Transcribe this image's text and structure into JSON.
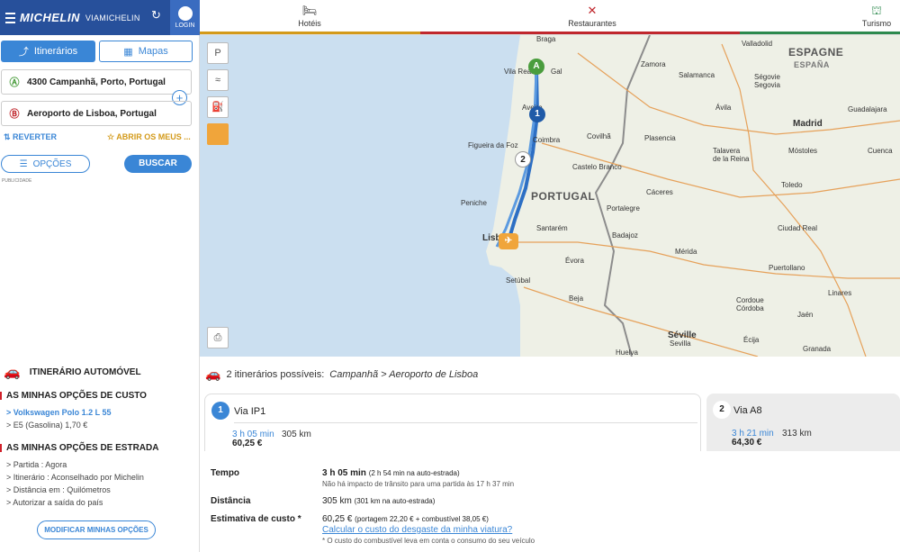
{
  "header": {
    "brand": "MICHELIN",
    "sub": "VIAMICHELIN",
    "login": "LOGIN"
  },
  "topnav": {
    "hotels": "Hotéis",
    "restaurants": "Restaurantes",
    "tourism": "Turismo",
    "hotels_color": "#d39a1a",
    "restaurants_color": "#c0272d",
    "tourism_color": "#2d8a4e"
  },
  "sidebar": {
    "tab_itineraries": "Itinerários",
    "tab_maps": "Mapas",
    "from": "4300 Campanhã, Porto, Portugal",
    "to": "Aeroporto de Lisboa, Portugal",
    "reverse": "REVERTER",
    "open_favs": "ABRIR OS MEUS ...",
    "options": "OPÇÕES",
    "search": "BUSCAR",
    "publicidade": "PUBLICIDADE",
    "itin_type": "ITINERÁRIO AUTOMÓVEL",
    "cost_title": "AS MINHAS OPÇÕES DE CUSTO",
    "car": "Volkswagen Polo 1.2 L 55",
    "fuel": "E5 (Gasolina) 1,70 €",
    "road_title": "AS MINHAS OPÇÕES DE ESTRADA",
    "road_opts": [
      "Partida : Agora",
      "Itinerário : Aconselhado por Michelin",
      "Distância em : Quilómetros",
      "Autorizar a saída do país"
    ],
    "modify": "MODIFICAR MINHAS OPÇÕES"
  },
  "map": {
    "country_es": "ESPAGNE",
    "country_es_sub": "ESPAÑA",
    "country_pt": "PORTUGAL",
    "cities": [
      {
        "name": "Braga"
      },
      {
        "name": "Vila Real"
      },
      {
        "name": "Gal"
      },
      {
        "name": "Zamora"
      },
      {
        "name": "Valladolid"
      },
      {
        "name": "Salamanca"
      },
      {
        "name": "Ségovie"
      },
      {
        "name": "Segovia"
      },
      {
        "name": "Ávila"
      },
      {
        "name": "Guadalajara"
      },
      {
        "name": "Madrid"
      },
      {
        "name": "Móstoles"
      },
      {
        "name": "Cuenca"
      },
      {
        "name": "Toledo"
      },
      {
        "name": "Aveiro"
      },
      {
        "name": "Figueira da Foz"
      },
      {
        "name": "Coimbra"
      },
      {
        "name": "Covilhã"
      },
      {
        "name": "Plasencia"
      },
      {
        "name": "Castelo Branco"
      },
      {
        "name": "Talavera"
      },
      {
        "name": "de la Reina"
      },
      {
        "name": "Cáceres"
      },
      {
        "name": "Peniche"
      },
      {
        "name": "Portalegre"
      },
      {
        "name": "Santarém"
      },
      {
        "name": "Badajoz"
      },
      {
        "name": "Mérida"
      },
      {
        "name": "Ciudad Real"
      },
      {
        "name": "Lisboa"
      },
      {
        "name": "Évora"
      },
      {
        "name": "Setúbal"
      },
      {
        "name": "Puertollano"
      },
      {
        "name": "Linares"
      },
      {
        "name": "Beja"
      },
      {
        "name": "Cordoue"
      },
      {
        "name": "Córdoba"
      },
      {
        "name": "Jaén"
      },
      {
        "name": "Séville"
      },
      {
        "name": "Sevilla"
      },
      {
        "name": "Écija"
      },
      {
        "name": "Huelva"
      },
      {
        "name": "Granada"
      }
    ]
  },
  "results": {
    "summary": "2 itinerários possíveis:",
    "route": "Campanhã > Aeroporto de Lisboa",
    "route1": {
      "num": "1",
      "title": "Via IP1",
      "time": "3 h 05 min",
      "dist": "305 km",
      "price": "60,25 €"
    },
    "route2": {
      "num": "2",
      "title": "Via A8",
      "time": "3 h 21 min",
      "dist": "313 km",
      "price": "64,30 €"
    },
    "detail": {
      "tempo_label": "Tempo",
      "tempo_val": "3 h 05 min",
      "tempo_extra": "(2 h 54 min na auto-estrada)",
      "tempo_sub": "Não há impacto de trânsito para uma partida às 17 h 37 min",
      "dist_label": "Distância",
      "dist_val": "305 km",
      "dist_extra": "(301 km na auto-estrada)",
      "cost_label": "Estimativa de custo *",
      "cost_val": "60,25 €",
      "cost_extra": "(portagem 22,20 € + combustível 38,05 €)",
      "cost_link": "Calcular o custo do desgaste da minha viatura?",
      "cost_note": "* O custo do combustível leva em conta o consumo do seu veículo"
    }
  }
}
